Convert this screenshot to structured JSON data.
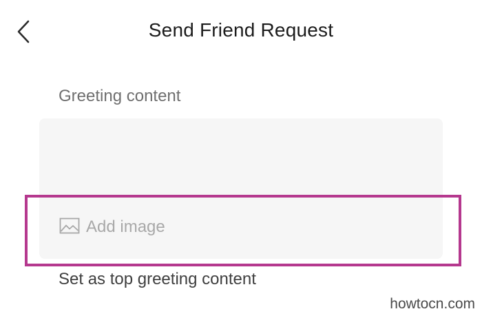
{
  "header": {
    "back_icon": "chevron-left-icon",
    "title": "Send Friend Request"
  },
  "greeting": {
    "label": "Greeting content",
    "text": "",
    "add_image_icon": "image-icon",
    "add_image_label": "Add image"
  },
  "options": {
    "top_greeting_label": "Set as top greeting content"
  },
  "annotation": {
    "highlight_color": "#b5388e"
  },
  "watermark": "howtocn.com"
}
